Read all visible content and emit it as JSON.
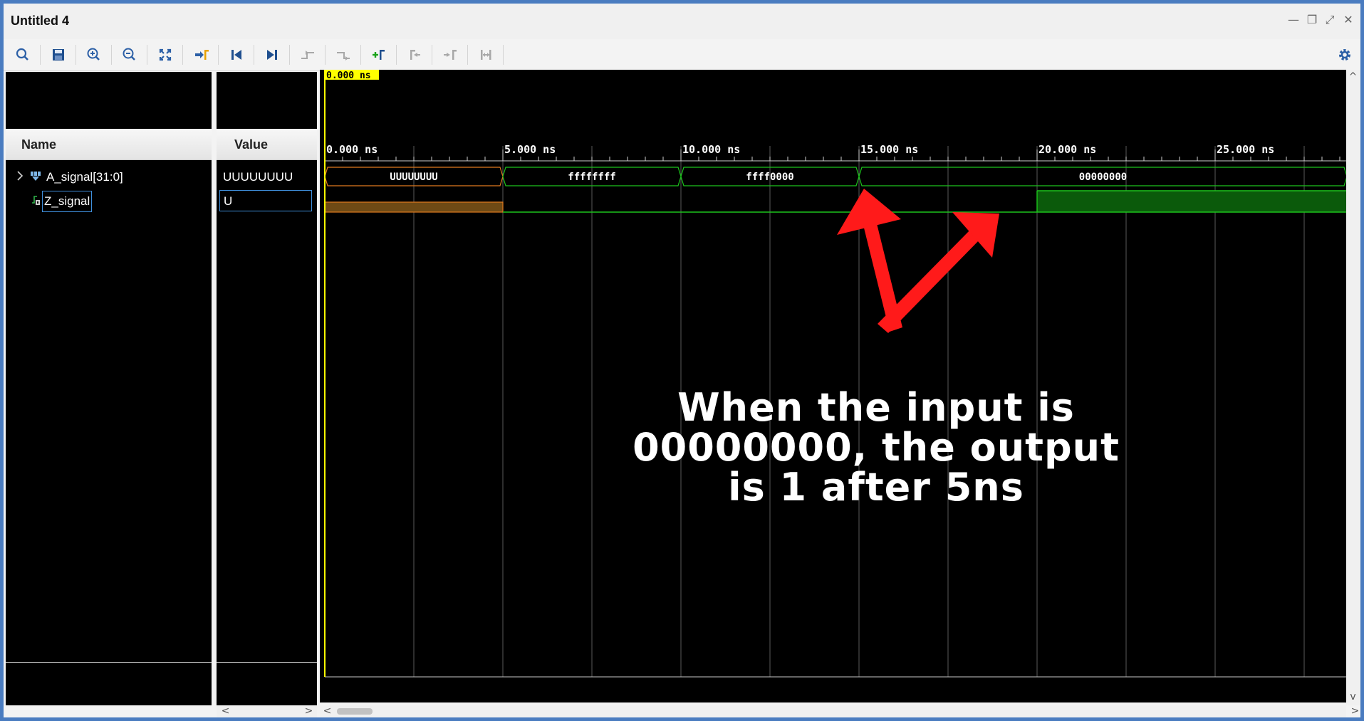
{
  "window": {
    "title": "Untitled 4",
    "minimize_glyph": "—",
    "restore_glyph": "❐",
    "maximize_glyph": "⤢",
    "close_glyph": "✕"
  },
  "toolbar": {
    "items": [
      {
        "icon": "search-icon"
      },
      {
        "icon": "save-icon"
      },
      {
        "icon": "zoom-in-icon"
      },
      {
        "icon": "zoom-out-icon"
      },
      {
        "icon": "zoom-fit-icon"
      },
      {
        "icon": "go-to-cursor-icon"
      },
      {
        "icon": "go-to-time-0-icon"
      },
      {
        "icon": "go-to-last-time-icon"
      },
      {
        "icon": "previous-transition-icon"
      },
      {
        "icon": "next-transition-icon"
      },
      {
        "icon": "add-marker-icon"
      },
      {
        "icon": "previous-marker-icon"
      },
      {
        "icon": "next-marker-icon"
      },
      {
        "icon": "swap-cursors-icon"
      },
      {
        "icon": "settings-icon"
      }
    ]
  },
  "columns": {
    "name": "Name",
    "value": "Value"
  },
  "signals": [
    {
      "name": "A_signal[31:0]",
      "value": "UUUUUUUU",
      "icon": "bus-icon",
      "expandable": true
    },
    {
      "name": "Z_signal",
      "value": "U",
      "icon": "bit-icon",
      "selected": true
    }
  ],
  "cursor": {
    "label": "0.000 ns",
    "time_ns": 0
  },
  "time_axis": {
    "ticks": [
      {
        "t": 0,
        "label": "0.000 ns"
      },
      {
        "t": 5,
        "label": "5.000 ns"
      },
      {
        "t": 10,
        "label": "10.000 ns"
      },
      {
        "t": 15,
        "label": "15.000 ns"
      },
      {
        "t": 20,
        "label": "20.000 ns"
      },
      {
        "t": 25,
        "label": "25.000 ns"
      }
    ],
    "visible_range_ns": [
      0,
      28.7
    ]
  },
  "waveform": {
    "bus_segments": [
      {
        "start": 0,
        "end": 5,
        "label": "UUUUUUUU",
        "state": "undefined"
      },
      {
        "start": 5,
        "end": 10,
        "label": "ffffffff",
        "state": "valid"
      },
      {
        "start": 10,
        "end": 15,
        "label": "ffff0000",
        "state": "valid"
      },
      {
        "start": 15,
        "end": 28.7,
        "label": "00000000",
        "state": "valid"
      }
    ],
    "bit_segments": [
      {
        "start": 0,
        "end": 5,
        "level": "U"
      },
      {
        "start": 5,
        "end": 20,
        "level": 0
      },
      {
        "start": 20,
        "end": 28.7,
        "level": 1
      }
    ]
  },
  "colors": {
    "undefined": "#e07a1f",
    "valid": "#1cc41c",
    "cursor": "#ffff00",
    "arrow": "#ff1a1a"
  },
  "annotation": {
    "line1": "When the input is",
    "line2": "00000000, the output",
    "line3": "is 1 after 5ns"
  },
  "scroll_arrows": {
    "left": "<",
    "right": ">",
    "up": "^",
    "down": "v"
  }
}
